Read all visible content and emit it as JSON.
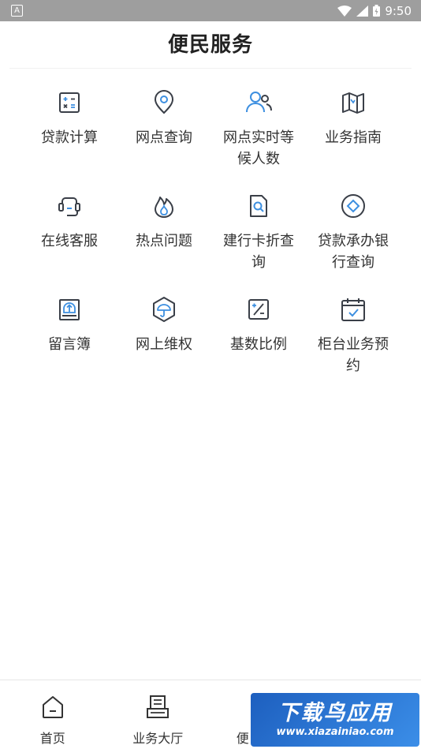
{
  "status_bar": {
    "time": "9:50"
  },
  "header": {
    "title": "便民服务"
  },
  "services": [
    {
      "label": "贷款计算",
      "icon": "calculator-icon"
    },
    {
      "label": "网点查询",
      "icon": "location-pin-icon"
    },
    {
      "label": "网点实时等候人数",
      "icon": "people-icon"
    },
    {
      "label": "业务指南",
      "icon": "map-icon"
    },
    {
      "label": "在线客服",
      "icon": "headset-icon"
    },
    {
      "label": "热点问题",
      "icon": "flame-icon"
    },
    {
      "label": "建行卡折查询",
      "icon": "document-search-icon"
    },
    {
      "label": "贷款承办银行查询",
      "icon": "diamond-circle-icon"
    },
    {
      "label": "留言簿",
      "icon": "inbox-icon"
    },
    {
      "label": "网上维权",
      "icon": "umbrella-shield-icon"
    },
    {
      "label": "基数比例",
      "icon": "percent-icon"
    },
    {
      "label": "柜台业务预约",
      "icon": "calendar-check-icon"
    }
  ],
  "tabbar": {
    "home": "首页",
    "business_hall": "业务大厅",
    "convenience_partial": "便"
  },
  "watermark": {
    "main": "下载鸟应用",
    "sub": "www.xiazainiao.com"
  },
  "colors": {
    "icon_dark": "#3a3f48",
    "icon_accent": "#3d8fe0",
    "status_bar": "#9e9e9e"
  }
}
